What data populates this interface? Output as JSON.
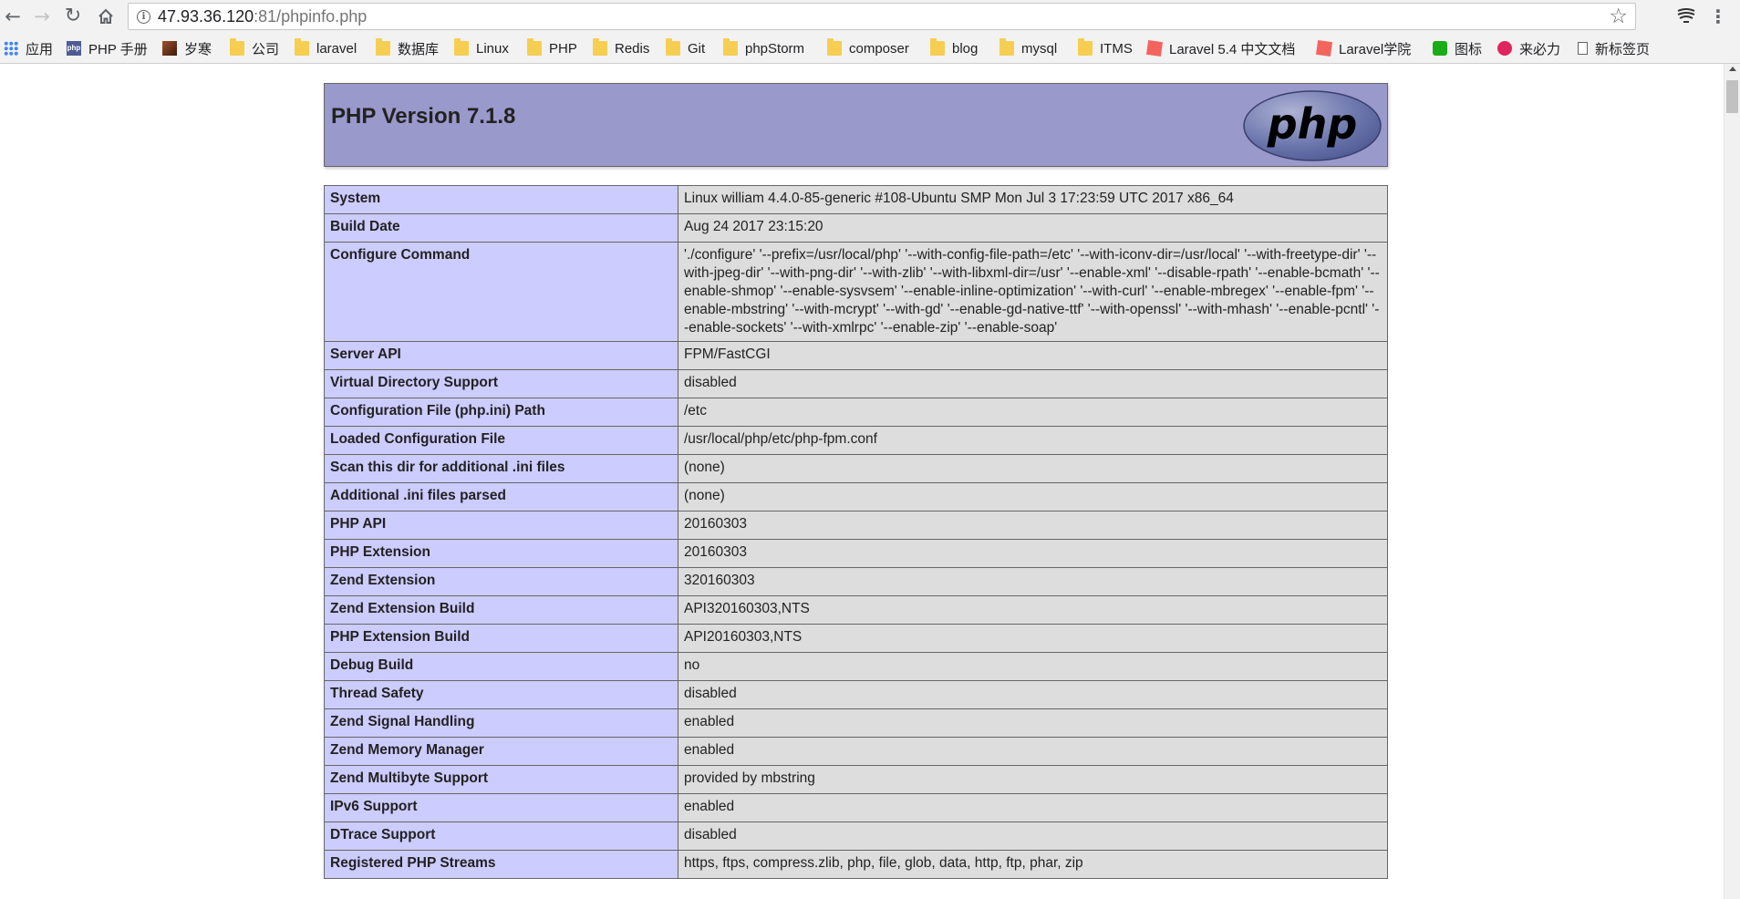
{
  "browser": {
    "url_host": "47.93.36.120",
    "url_rest": ":81/phpinfo.php",
    "icons": {
      "back": "back-arrow-icon",
      "forward": "forward-arrow-icon",
      "reload": "reload-icon",
      "home": "home-icon",
      "info": "info-icon",
      "star": "star-icon",
      "extension": "extension-icon",
      "menu": "menu-icon"
    }
  },
  "bookmarks": [
    {
      "label": "应用",
      "icon": "apps-grid-icon"
    },
    {
      "label": "PHP 手册",
      "icon": "php-manual-icon"
    },
    {
      "label": "岁寒",
      "icon": "avatar-icon"
    },
    {
      "label": "公司",
      "icon": "folder-icon"
    },
    {
      "label": "laravel",
      "icon": "folder-icon"
    },
    {
      "label": "数据库",
      "icon": "folder-icon"
    },
    {
      "label": "Linux",
      "icon": "folder-icon"
    },
    {
      "label": "PHP",
      "icon": "folder-icon"
    },
    {
      "label": "Redis",
      "icon": "folder-icon"
    },
    {
      "label": "Git",
      "icon": "folder-icon"
    },
    {
      "label": "phpStorm",
      "icon": "folder-icon"
    },
    {
      "label": "composer",
      "icon": "folder-icon"
    },
    {
      "label": "blog",
      "icon": "folder-icon"
    },
    {
      "label": "mysql",
      "icon": "folder-icon"
    },
    {
      "label": "ITMS",
      "icon": "folder-icon"
    },
    {
      "label": "Laravel 5.4 中文文档",
      "icon": "laravel-icon"
    },
    {
      "label": "Laravel学院",
      "icon": "laravel-icon"
    },
    {
      "label": "图标",
      "icon": "iconfont-icon"
    },
    {
      "label": "来必力",
      "icon": "livere-icon"
    },
    {
      "label": "新标签页",
      "icon": "page-icon"
    }
  ],
  "page": {
    "title": "PHP Version 7.1.8",
    "logo_text": "php",
    "rows": [
      {
        "key": "System",
        "value": "Linux william 4.4.0-85-generic #108-Ubuntu SMP Mon Jul 3 17:23:59 UTC 2017 x86_64"
      },
      {
        "key": "Build Date",
        "value": "Aug 24 2017 23:15:20"
      },
      {
        "key": "Configure Command",
        "value": "'./configure' '--prefix=/usr/local/php' '--with-config-file-path=/etc' '--with-iconv-dir=/usr/local' '--with-freetype-dir' '--with-jpeg-dir' '--with-png-dir' '--with-zlib' '--with-libxml-dir=/usr' '--enable-xml' '--disable-rpath' '--enable-bcmath' '--enable-shmop' '--enable-sysvsem' '--enable-inline-optimization' '--with-curl' '--enable-mbregex' '--enable-fpm' '--enable-mbstring' '--with-mcrypt' '--with-gd' '--enable-gd-native-ttf' '--with-openssl' '--with-mhash' '--enable-pcntl' '--enable-sockets' '--with-xmlrpc' '--enable-zip' '--enable-soap'"
      },
      {
        "key": "Server API",
        "value": "FPM/FastCGI"
      },
      {
        "key": "Virtual Directory Support",
        "value": "disabled"
      },
      {
        "key": "Configuration File (php.ini) Path",
        "value": "/etc"
      },
      {
        "key": "Loaded Configuration File",
        "value": "/usr/local/php/etc/php-fpm.conf"
      },
      {
        "key": "Scan this dir for additional .ini files",
        "value": "(none)"
      },
      {
        "key": "Additional .ini files parsed",
        "value": "(none)"
      },
      {
        "key": "PHP API",
        "value": "20160303"
      },
      {
        "key": "PHP Extension",
        "value": "20160303"
      },
      {
        "key": "Zend Extension",
        "value": "320160303"
      },
      {
        "key": "Zend Extension Build",
        "value": "API320160303,NTS"
      },
      {
        "key": "PHP Extension Build",
        "value": "API20160303,NTS"
      },
      {
        "key": "Debug Build",
        "value": "no"
      },
      {
        "key": "Thread Safety",
        "value": "disabled"
      },
      {
        "key": "Zend Signal Handling",
        "value": "enabled"
      },
      {
        "key": "Zend Memory Manager",
        "value": "enabled"
      },
      {
        "key": "Zend Multibyte Support",
        "value": "provided by mbstring"
      },
      {
        "key": "IPv6 Support",
        "value": "enabled"
      },
      {
        "key": "DTrace Support",
        "value": "disabled"
      },
      {
        "key": "Registered PHP Streams",
        "value": "https, ftps, compress.zlib, php, file, glob, data, http, ftp, phar, zip"
      }
    ]
  },
  "colors": {
    "header_bg": "#9999cc",
    "key_bg": "#ccccff",
    "value_bg": "#dddddd",
    "logo_bg": "#6181b6"
  }
}
